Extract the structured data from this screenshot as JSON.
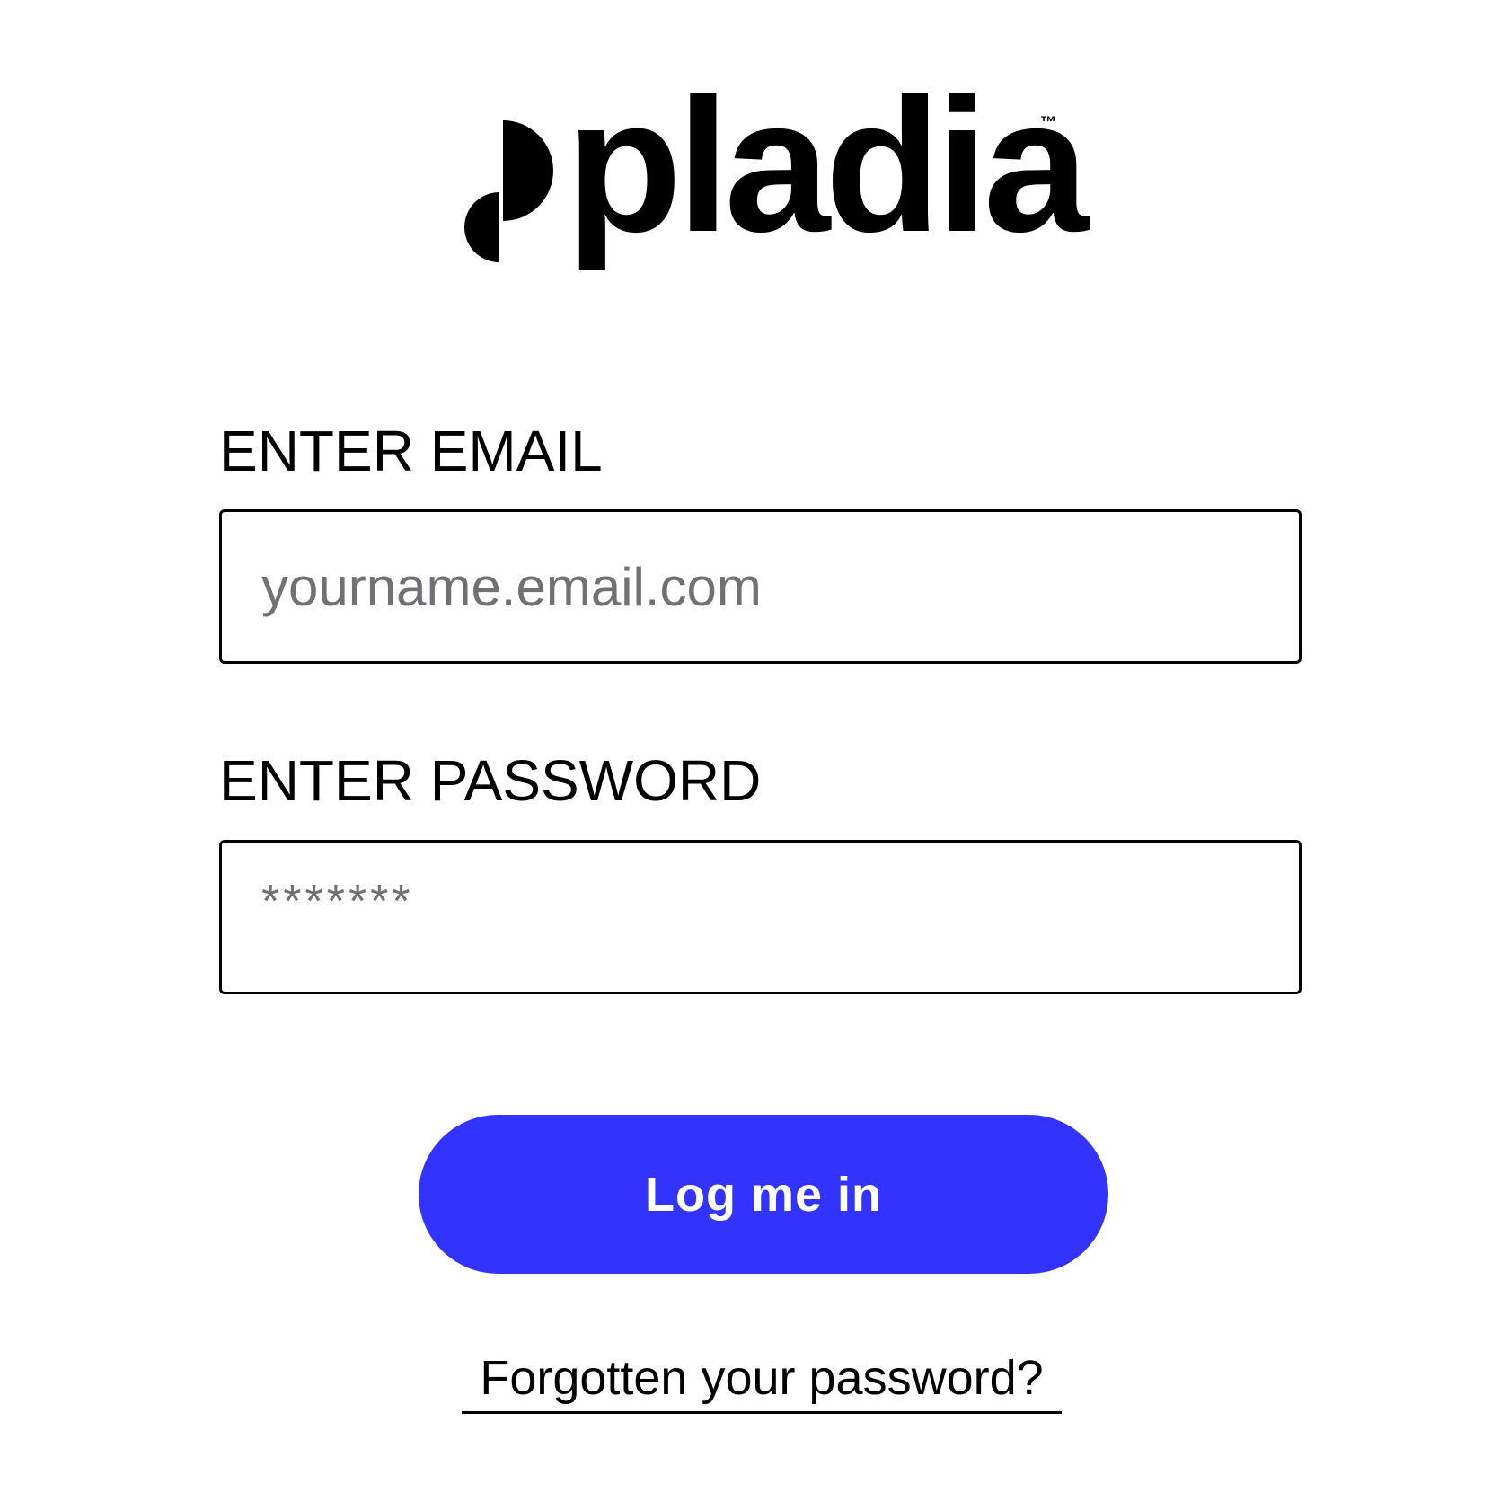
{
  "logo": {
    "wordmark": "pladia",
    "trademark": "™"
  },
  "email": {
    "label": "ENTER EMAIL",
    "placeholder": "yourname.email.com",
    "value": ""
  },
  "password": {
    "label": "ENTER PASSWORD",
    "placeholder": "*******",
    "value": ""
  },
  "login_button": {
    "label": "Log me in",
    "color": "#3333ff"
  },
  "forgot_password": {
    "label": "Forgotten your password?"
  }
}
